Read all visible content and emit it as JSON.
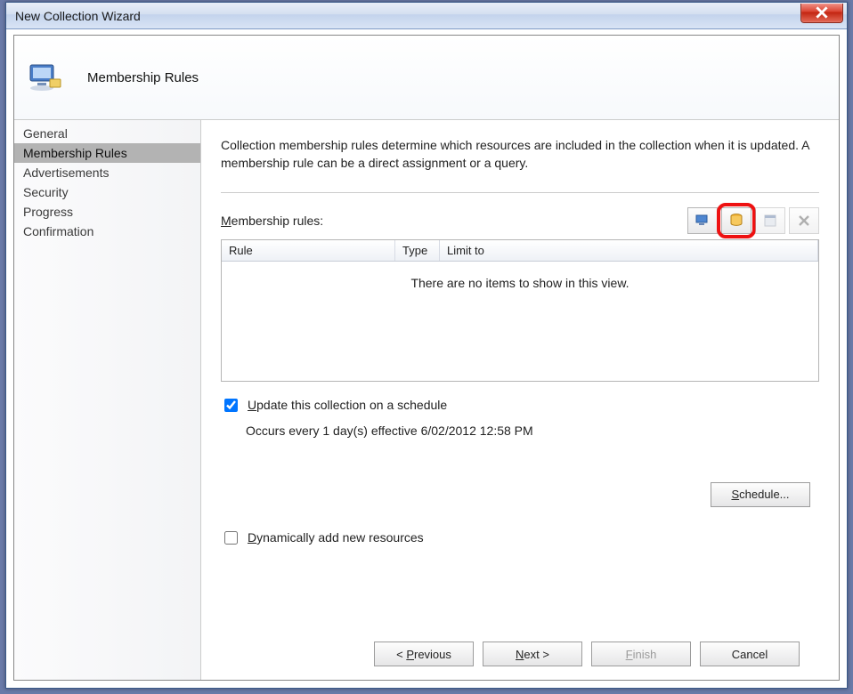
{
  "window": {
    "title": "New Collection Wizard"
  },
  "header": {
    "page_title": "Membership Rules"
  },
  "sidebar": {
    "items": [
      {
        "label": "General"
      },
      {
        "label": "Membership Rules"
      },
      {
        "label": "Advertisements"
      },
      {
        "label": "Security"
      },
      {
        "label": "Progress"
      },
      {
        "label": "Confirmation"
      }
    ],
    "selected_index": 1
  },
  "content": {
    "description": "Collection membership rules determine which resources are included in the collection when it is updated. A membership rule can be a direct assignment or a query.",
    "rules_label_pre": "M",
    "rules_label_rest": "embership rules:",
    "columns": {
      "rule": "Rule",
      "type": "Type",
      "limit": "Limit to"
    },
    "empty_text": "There are no items to show in this view.",
    "update_checkbox_pre": "U",
    "update_checkbox_rest": "pdate this collection on a schedule",
    "update_checked": true,
    "schedule_text": "Occurs every 1 day(s) effective 6/02/2012 12:58 PM",
    "schedule_button_pre": "S",
    "schedule_button_rest": "chedule...",
    "dyn_label_pre": "D",
    "dyn_label_rest": "ynamically add new resources",
    "dyn_checked": false
  },
  "footer": {
    "previous_pre": "< ",
    "previous_mid": "P",
    "previous_rest": "revious",
    "next_pre": "N",
    "next_rest": "ext >",
    "finish_pre": "F",
    "finish_rest": "inish",
    "cancel": "Cancel"
  }
}
